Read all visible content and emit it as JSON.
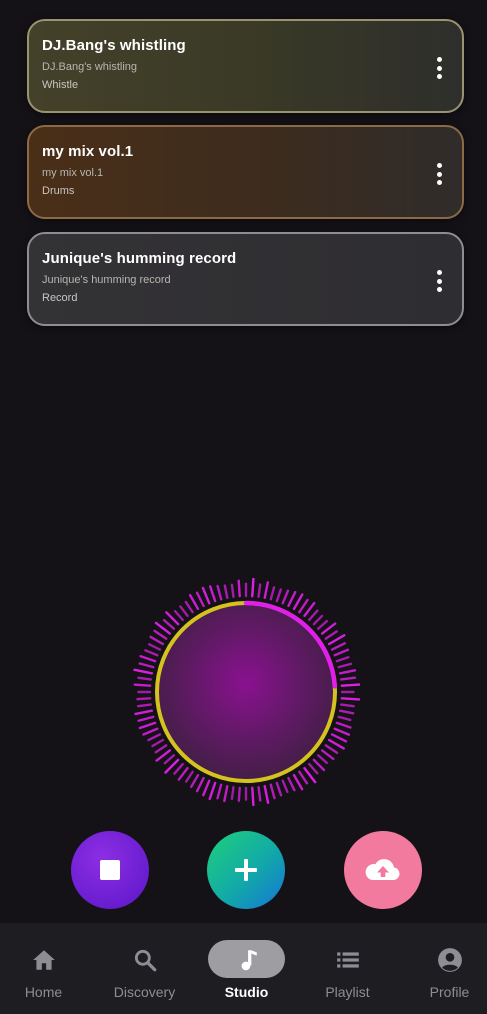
{
  "tracks": [
    {
      "title": "DJ.Bang's whistling",
      "subtitle": "DJ.Bang's whistling",
      "tag": "Whistle"
    },
    {
      "title": "my mix vol.1",
      "subtitle": "my mix vol.1",
      "tag": "Drums"
    },
    {
      "title": "Junique's humming record",
      "subtitle": "Junique's humming record",
      "tag": "Record"
    }
  ],
  "recorder": {
    "progress": 0.24,
    "ring_color": "#d6c21f",
    "progress_color": "#e020e8",
    "level_color": "#e11ee8"
  },
  "actions": {
    "stop": "stop-icon",
    "add": "plus-icon",
    "upload": "cloud-upload-icon"
  },
  "nav": {
    "items": [
      {
        "label": "Home",
        "icon": "home-icon"
      },
      {
        "label": "Discovery",
        "icon": "search-icon"
      },
      {
        "label": "Studio",
        "icon": "music-note-icon"
      },
      {
        "label": "Playlist",
        "icon": "list-icon"
      },
      {
        "label": "Profile",
        "icon": "account-icon"
      }
    ],
    "active": "Studio"
  }
}
